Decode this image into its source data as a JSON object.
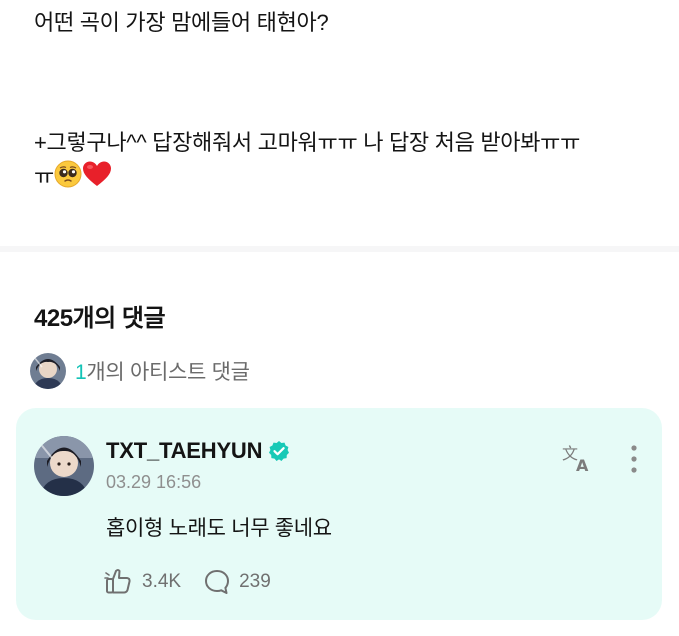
{
  "post": {
    "line1": "어떤 곡이 가장 맘에들어 태현아?",
    "line2": "+그렇구나^^ 답장해줘서 고마워ㅠㅠ 나 답장 처음 받아봐ㅠㅠ",
    "line3": "ㅠ"
  },
  "comments": {
    "count_label": "425개의 댓글",
    "artist_count": "1",
    "artist_label": "개의 아티스트 댓글"
  },
  "artist_comment": {
    "author": "TXT_TAEHYUN",
    "timestamp": "03.29 16:56",
    "text": "홉이형 노래도 너무 좋네요",
    "likes": "3.4K",
    "replies": "239"
  },
  "colors": {
    "accent": "#13c3b6",
    "card_bg": "#e6fbf7",
    "verified": "#18c9b6"
  },
  "icons": [
    "pleading-face-emoji",
    "red-heart-emoji",
    "verified-badge-icon",
    "translate-icon",
    "more-vertical-icon",
    "like-icon",
    "reply-icon"
  ]
}
